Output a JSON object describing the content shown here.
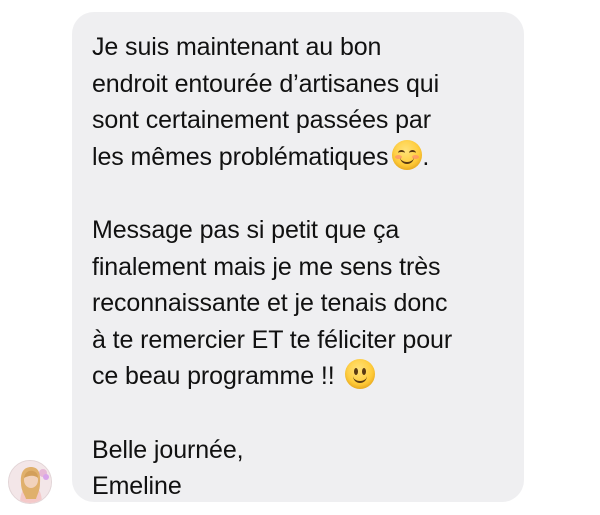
{
  "message": {
    "paragraphs": [
      {
        "lines": [
          "Je suis maintenant au bon",
          "endroit entourée d’artisanes qui",
          "sont certainement passées par",
          "les mêmes problématiques"
        ],
        "trailing_emoji": "smiling-face-with-smiling-eyes",
        "trailing_text": "."
      },
      {
        "lines": [
          "Message pas si petit que ça",
          "finalement mais je me sens très",
          "reconnaissante et je tenais donc",
          "à te remercier ET te féliciter pour",
          "ce beau programme !!"
        ],
        "trailing_emoji": "slightly-smiling-face"
      },
      {
        "lines": [
          "Belle journée,",
          "Emeline"
        ]
      }
    ]
  },
  "sender": {
    "avatar_icon": "profile-photo"
  },
  "colors": {
    "bubble_background": "#efeff1",
    "text": "#111111"
  }
}
